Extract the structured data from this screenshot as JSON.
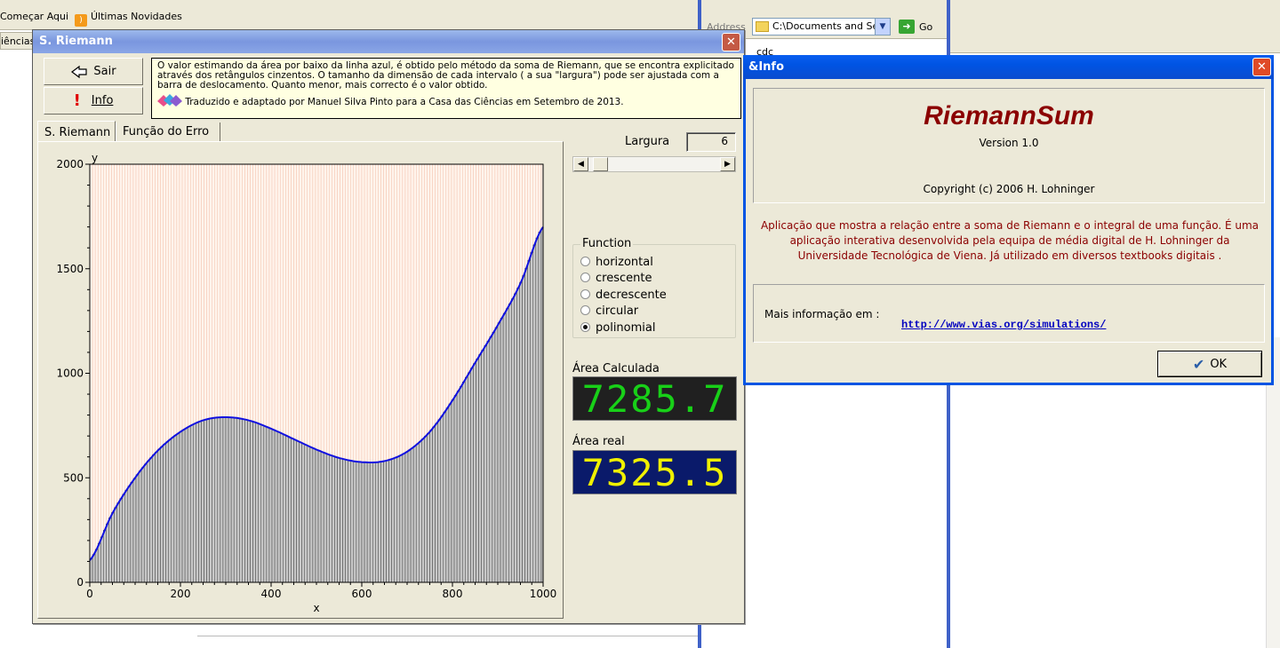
{
  "background": {
    "favorites": [
      "Começar Aqui",
      "Últimas Novidades"
    ],
    "left_fragment": "iências",
    "address_label": "Address",
    "address_value": "C:\\Documents and Set",
    "go_label": "Go",
    "folder_item": "cdc"
  },
  "main_window": {
    "title": "S. Riemann",
    "buttons": {
      "exit": "Sair",
      "info": "Info"
    },
    "description": "O valor estimando da área por baixo da linha azul, é obtido pelo método da soma de Riemann, que se encontra explicitado através dos retângulos cinzentos. O tamanho da dimensão de cada intervalo ( a sua \"largura\") pode ser ajustada com a barra de deslocamento. Quanto menor, mais correcto é o valor obtido.",
    "credit": "Traduzido e adaptado por Manuel Silva Pinto para a Casa das Ciências em Setembro de 2013.",
    "tabs": [
      "S. Riemann",
      "Função do Erro"
    ],
    "width_label": "Largura",
    "width_value": "6",
    "width_slider": 0.03,
    "function_group": {
      "legend": "Function",
      "options": [
        "horizontal",
        "crescente",
        "decrescente",
        "circular",
        "polinomial"
      ],
      "selected": "polinomial"
    },
    "area_calc_label": "Área Calculada",
    "area_calc_value": "7285.7",
    "area_real_label": "Área real",
    "area_real_value": "7325.5",
    "colors": {
      "calc_digits": "#18d018",
      "real_digits": "#f0f000",
      "real_bg": "#0a1a6a",
      "curve": "#1010e0"
    }
  },
  "chart_data": {
    "type": "area",
    "xlabel": "x",
    "ylabel": "y",
    "xlim": [
      0,
      1000
    ],
    "ylim": [
      0,
      2000
    ],
    "x_ticks": [
      0,
      200,
      400,
      600,
      800,
      1000
    ],
    "y_ticks": [
      0,
      500,
      1000,
      1500,
      2000
    ],
    "interval_width": 6,
    "x": [
      0,
      50,
      100,
      150,
      200,
      250,
      300,
      350,
      400,
      450,
      500,
      550,
      600,
      650,
      700,
      750,
      800,
      850,
      900,
      950,
      1000
    ],
    "y": [
      105,
      330,
      500,
      630,
      720,
      775,
      790,
      775,
      735,
      685,
      635,
      595,
      575,
      580,
      625,
      720,
      870,
      1050,
      1230,
      1430,
      1700
    ]
  },
  "info_dialog": {
    "title": "&Info",
    "app_name": "RiemannSum",
    "version": "Version 1.0",
    "copyright": "Copyright (c) 2006 H. Lohninger",
    "description": "Aplicação que mostra a relação entre a soma de Riemann e o integral de uma função. É uma aplicação interativa desenvolvida pela equipa de média digital de H. Lohninger da Universidade Tecnológica de Viena. Já utilizado em diversos textbooks digitais .",
    "more_info_label": "Mais informação em :",
    "link": "http://www.vias.org/simulations/",
    "ok_label": "OK"
  }
}
